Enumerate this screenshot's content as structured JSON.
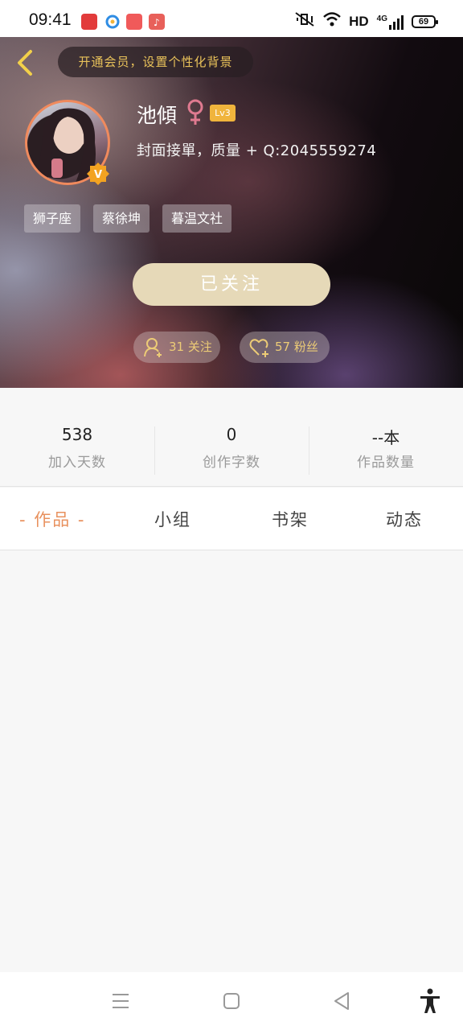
{
  "status_bar": {
    "time": "09:41",
    "network": "HD",
    "cell": "4G",
    "battery": "69"
  },
  "header": {
    "vip_prompt": "开通会员，设置个性化背景",
    "name": "池傾",
    "level": "Lv3",
    "bio": "封面接單，质量 + Q:2045559274",
    "tags": [
      "狮子座",
      "蔡徐坤",
      "暮温文社"
    ],
    "follow_button": "已关注",
    "following": "31 关注",
    "fans": "57 粉丝"
  },
  "stats": [
    {
      "value": "538",
      "label": "加入天数"
    },
    {
      "value": "0",
      "label": "创作字数"
    },
    {
      "value": "--本",
      "label": "作品数量"
    }
  ],
  "tabs": [
    "- 作品 -",
    "小组",
    "书架",
    "动态"
  ],
  "colors": {
    "accent": "#e8915e",
    "gold": "#e9c25a",
    "follow_button": "#e6d9b8",
    "level_badge": "#f0b43c"
  }
}
